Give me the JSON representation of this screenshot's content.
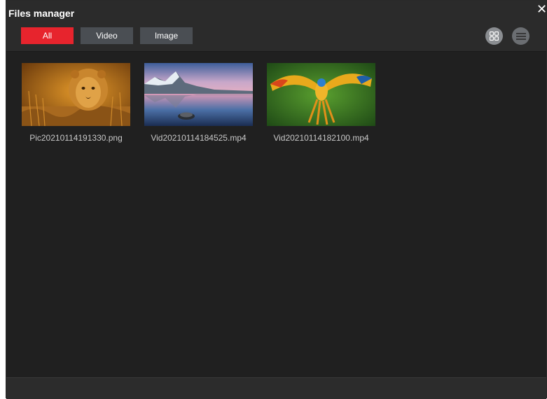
{
  "window": {
    "title": "Files manager"
  },
  "filters": [
    {
      "label": "All",
      "active": true
    },
    {
      "label": "Video",
      "active": false
    },
    {
      "label": "Image",
      "active": false
    }
  ],
  "view_modes": [
    {
      "icon": "grid-view-icon",
      "active": true
    },
    {
      "icon": "list-view-icon",
      "active": false
    }
  ],
  "files": [
    {
      "name": "Pic20210114191330.png",
      "type": "image",
      "thumbnail": "lion-cub-icon"
    },
    {
      "name": "Vid20210114184525.mp4",
      "type": "video",
      "thumbnail": "mountain-lake-icon"
    },
    {
      "name": "Vid20210114182100.mp4",
      "type": "video",
      "thumbnail": "parrot-icon"
    }
  ],
  "colors": {
    "accent": "#e7242d",
    "background": "#202020",
    "header": "#2b2b2b"
  }
}
